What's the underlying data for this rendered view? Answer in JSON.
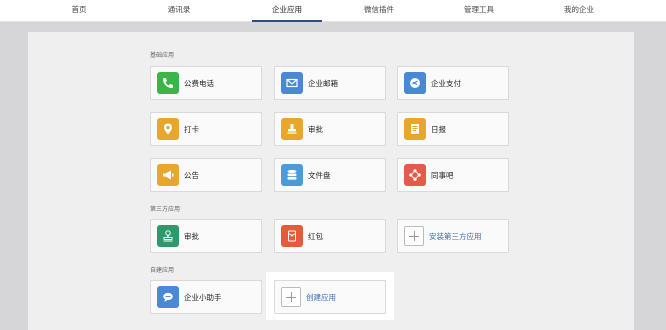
{
  "nav": {
    "items": [
      "首页",
      "通讯录",
      "企业应用",
      "微信插件",
      "管理工具",
      "我的企业"
    ],
    "active_index": 2
  },
  "sections": {
    "basic": "基础应用",
    "third_party": "第三方应用",
    "custom": "自建应用"
  },
  "apps": {
    "call": "公费电话",
    "mail": "企业邮箱",
    "pay": "企业支付",
    "checkin": "打卡",
    "approval": "审批",
    "daily": "日报",
    "notice": "公告",
    "disk": "文件盘",
    "forum": "同事吧",
    "third_approval": "审批",
    "hongbao": "红包",
    "install_third": "安装第三方应用",
    "assistant": "企业小助手",
    "create": "创建应用"
  },
  "colors": {
    "call": "#3bb54a",
    "mail": "#4a87d4",
    "pay": "#4a87d4",
    "checkin": "#e8a62c",
    "approval": "#e8a62c",
    "daily": "#e8a62c",
    "notice": "#e8a62c",
    "disk": "#4a9bd8",
    "forum": "#e55a4a",
    "third_approval": "#2e9a6c",
    "hongbao": "#e55a3a",
    "assistant": "#4a87d4",
    "active_nav_underline": "#2f4f7a",
    "link_blue": "#3a6fb0"
  }
}
